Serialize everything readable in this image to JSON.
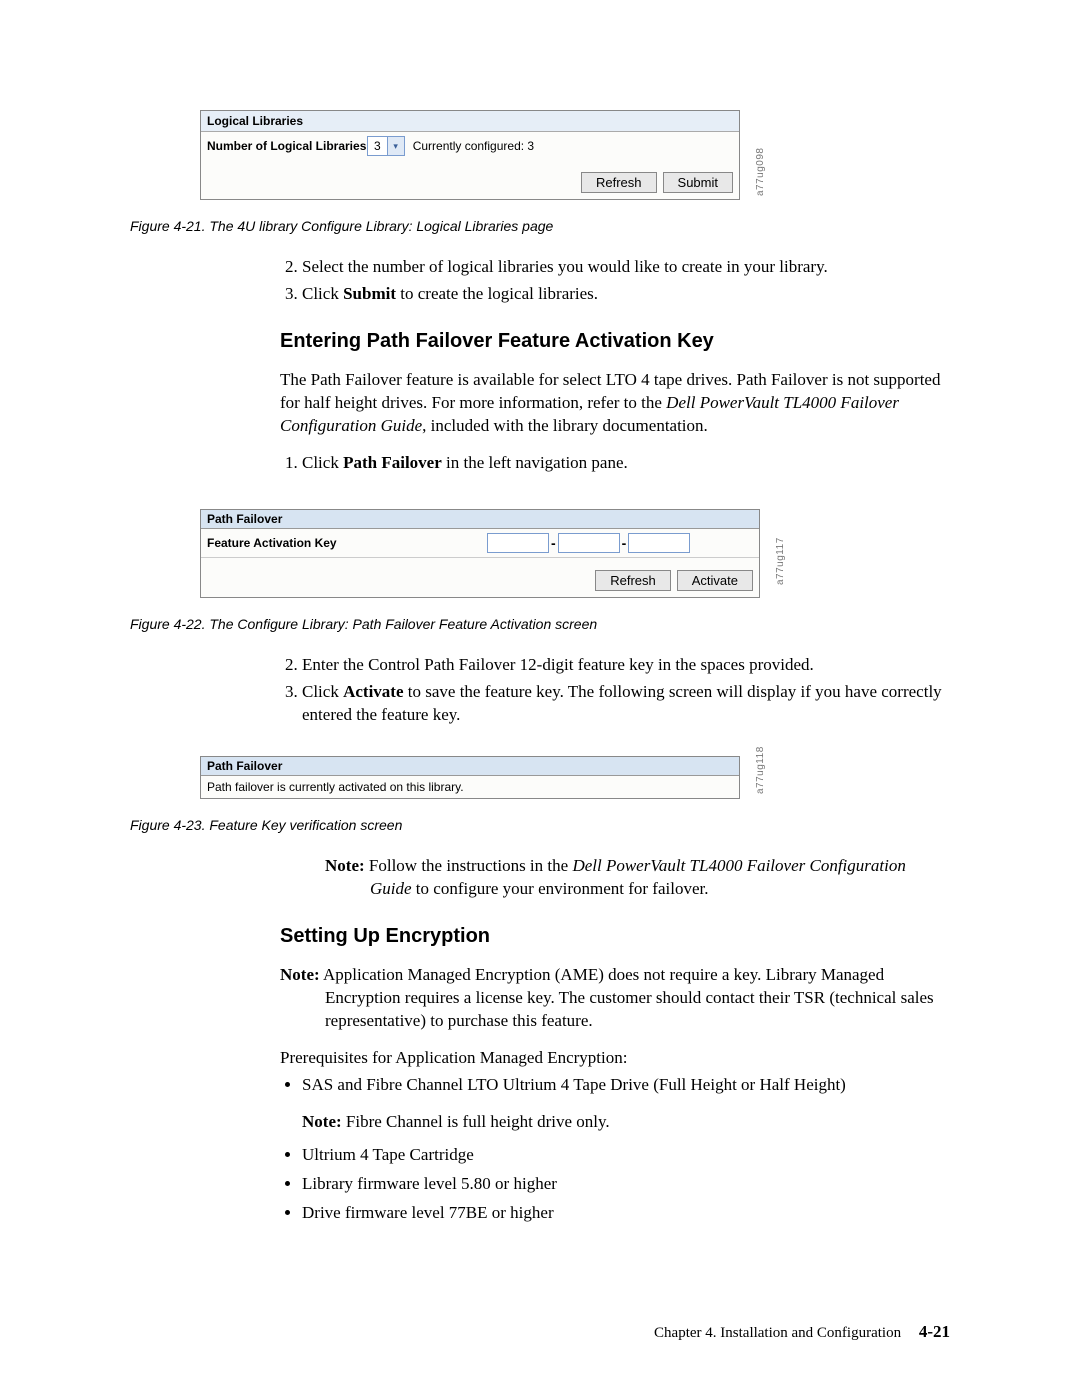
{
  "figure21": {
    "header": "Logical Libraries",
    "label": "Number of Logical Libraries",
    "select_value": "3",
    "currently": "Currently configured: 3",
    "refresh": "Refresh",
    "submit": "Submit",
    "sidelabel": "a77ug098",
    "caption": "Figure 4-21. The 4U library Configure Library: Logical Libraries page"
  },
  "steps_a": {
    "s2": "Select the number of logical libraries you would like to create in your library.",
    "s3_pre": "Click ",
    "s3_bold": "Submit",
    "s3_post": " to create the logical libraries."
  },
  "section1_title": "Entering Path Failover Feature Activation Key",
  "para1_a": "The Path Failover feature is available for select LTO 4 tape drives. Path Failover is not supported for half height drives. For more information, refer to the ",
  "para1_i": "Dell PowerVault TL4000 Failover Configuration Guide",
  "para1_b": ", included with the library documentation.",
  "steps_b": {
    "s1_pre": "Click ",
    "s1_bold": "Path Failover",
    "s1_post": " in the left navigation pane."
  },
  "figure22": {
    "header": "Path Failover",
    "label": "Feature Activation Key",
    "refresh": "Refresh",
    "activate": "Activate",
    "sidelabel": "a77ug117",
    "caption": "Figure 4-22. The Configure Library: Path Failover Feature Activation screen"
  },
  "steps_c": {
    "s2": "Enter the Control Path Failover 12-digit feature key in the spaces provided.",
    "s3_pre": "Click ",
    "s3_bold": "Activate",
    "s3_post": " to save the feature key. The following screen will display if you have correctly entered the feature key."
  },
  "figure23": {
    "header": "Path Failover",
    "status": "Path failover is currently activated on this library.",
    "sidelabel": "a77ug118",
    "caption": "Figure 4-23. Feature Key verification screen"
  },
  "note1_pre": "Note:",
  "note1_a": " Follow the instructions in the ",
  "note1_i": "Dell PowerVault TL4000 Failover Configuration Guide",
  "note1_b": " to configure your environment for failover.",
  "section2_title": "Setting Up Encryption",
  "note2_pre": "Note:",
  "note2_body": " Application Managed Encryption (AME) does not require a key. Library Managed Encryption requires a license key. The customer should contact their TSR (technical sales representative) to purchase this feature.",
  "prereq_intro": "Prerequisites for Application Managed Encryption:",
  "bullets": {
    "b1": "SAS and Fibre Channel LTO Ultrium 4 Tape Drive (Full Height or Half Height)",
    "b1_note_pre": "Note:",
    "b1_note_body": " Fibre Channel is full height drive only.",
    "b2": "Ultrium 4 Tape Cartridge",
    "b3": "Library firmware level 5.80 or higher",
    "b4": "Drive firmware level 77BE or higher"
  },
  "footer_chapter": "Chapter 4. Installation and Configuration",
  "footer_page": "4-21"
}
